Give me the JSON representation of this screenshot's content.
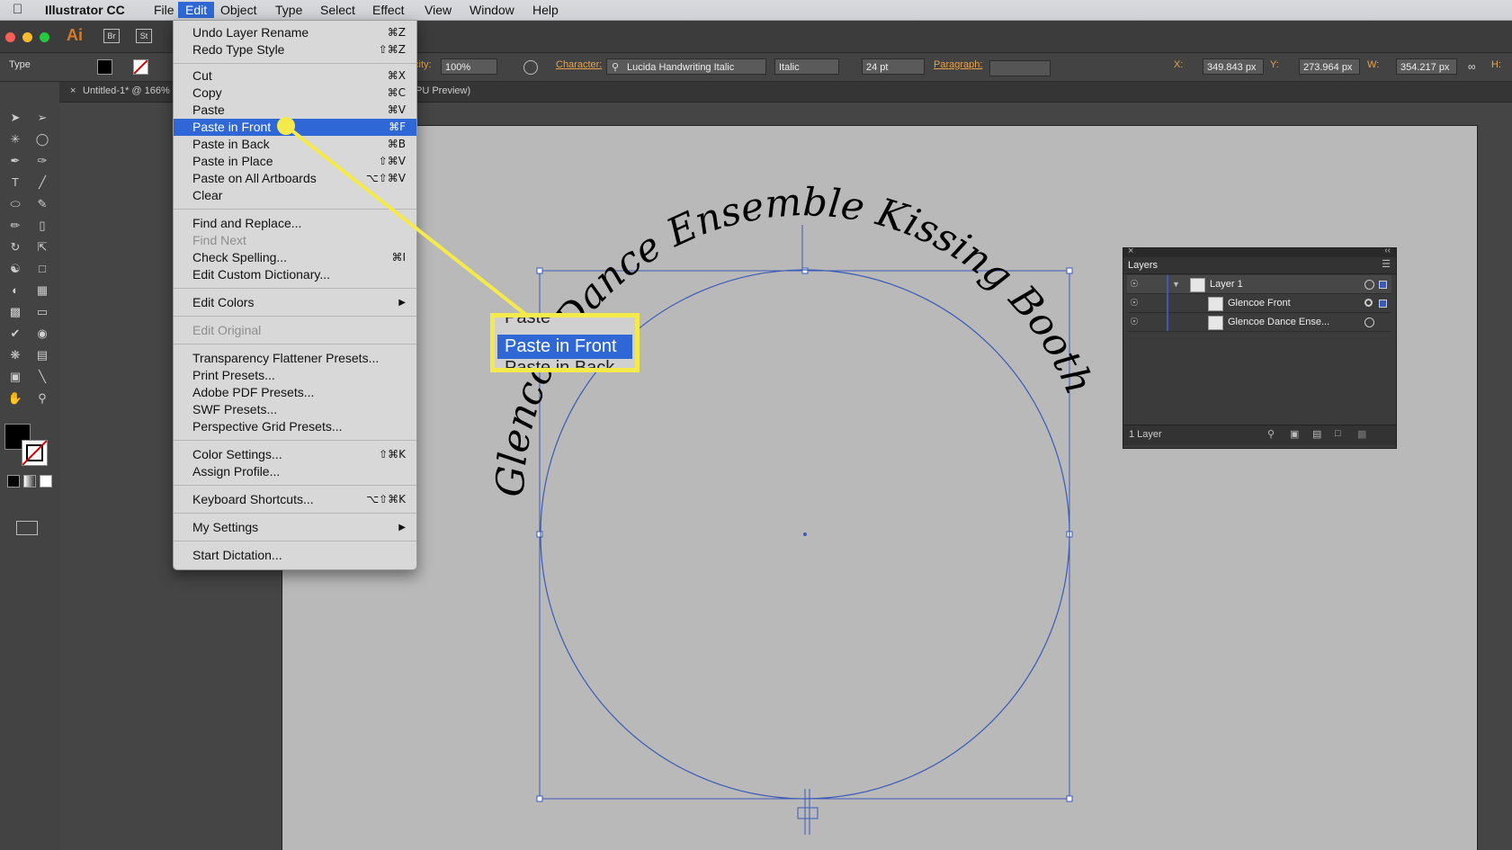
{
  "mac_menu": {
    "app_name": "Illustrator CC",
    "items": [
      "File",
      "Edit",
      "Object",
      "Type",
      "Select",
      "Effect",
      "View",
      "Window",
      "Help"
    ],
    "active": "Edit"
  },
  "app_bar": {
    "logo": "Ai",
    "buttons": [
      "Br",
      "St"
    ]
  },
  "control_bar": {
    "tool_label": "Type",
    "opacity_label": "city:",
    "opacity_value": "100%",
    "character_label": "Character:",
    "font_family": "Lucida Handwriting Italic",
    "font_style": "Italic",
    "font_size": "24 pt",
    "paragraph_label": "Paragraph:",
    "x_label": "X:",
    "x_value": "349.843 px",
    "y_label": "Y:",
    "y_value": "273.964 px",
    "w_label": "W:",
    "w_value": "354.217 px",
    "h_label": "H:"
  },
  "document_tab": {
    "title": "Untitled-1* @ 166%",
    "title_tail": "PU Preview)",
    "close": "×"
  },
  "edit_menu": {
    "items": [
      {
        "label": "Undo Layer Rename",
        "shortcut": "⌘Z"
      },
      {
        "label": "Redo Type Style",
        "shortcut": "⇧⌘Z"
      },
      {
        "label": "Cut",
        "shortcut": "⌘X"
      },
      {
        "label": "Copy",
        "shortcut": "⌘C"
      },
      {
        "label": "Paste",
        "shortcut": "⌘V"
      },
      {
        "label": "Paste in Front",
        "shortcut": "⌘F"
      },
      {
        "label": "Paste in Back",
        "shortcut": "⌘B"
      },
      {
        "label": "Paste in Place",
        "shortcut": "⇧⌘V"
      },
      {
        "label": "Paste on All Artboards",
        "shortcut": "⌥⇧⌘V"
      },
      {
        "label": "Clear",
        "shortcut": ""
      },
      {
        "label": "Find and Replace...",
        "shortcut": ""
      },
      {
        "label": "Find Next",
        "shortcut": ""
      },
      {
        "label": "Check Spelling...",
        "shortcut": "⌘I"
      },
      {
        "label": "Edit Custom Dictionary...",
        "shortcut": ""
      },
      {
        "label": "Edit Colors",
        "shortcut": ""
      },
      {
        "label": "Edit Original",
        "shortcut": ""
      },
      {
        "label": "Transparency Flattener Presets...",
        "shortcut": ""
      },
      {
        "label": "Print Presets...",
        "shortcut": ""
      },
      {
        "label": "Adobe PDF Presets...",
        "shortcut": ""
      },
      {
        "label": "SWF Presets...",
        "shortcut": ""
      },
      {
        "label": "Perspective Grid Presets...",
        "shortcut": ""
      },
      {
        "label": "Color Settings...",
        "shortcut": "⇧⌘K"
      },
      {
        "label": "Assign Profile...",
        "shortcut": ""
      },
      {
        "label": "Keyboard Shortcuts...",
        "shortcut": "⌥⇧⌘K"
      },
      {
        "label": "My Settings",
        "shortcut": ""
      },
      {
        "label": "Start Dictation...",
        "shortcut": ""
      }
    ],
    "submenu_arrow": "▶",
    "highlighted": "Paste in Front"
  },
  "callout": {
    "above": "Paste",
    "highlight": "Paste in Front",
    "below": "Paste in Back"
  },
  "artwork": {
    "path_text": "Glencoe Dance Ensemble Kissing Booth"
  },
  "layers_panel": {
    "title": "Layers",
    "close": "×",
    "collapse": "‹‹",
    "rows": [
      {
        "name": "Layer 1"
      },
      {
        "name": "Glencoe Front"
      },
      {
        "name": "Glencoe Dance Ense..."
      }
    ],
    "footer": "1 Layer"
  },
  "colors": {
    "menu_highlight": "#2f68d6",
    "callout_yellow": "#f5ea4c",
    "selection_blue": "#3b5bb5",
    "accent_orange": "#e6a34a"
  }
}
